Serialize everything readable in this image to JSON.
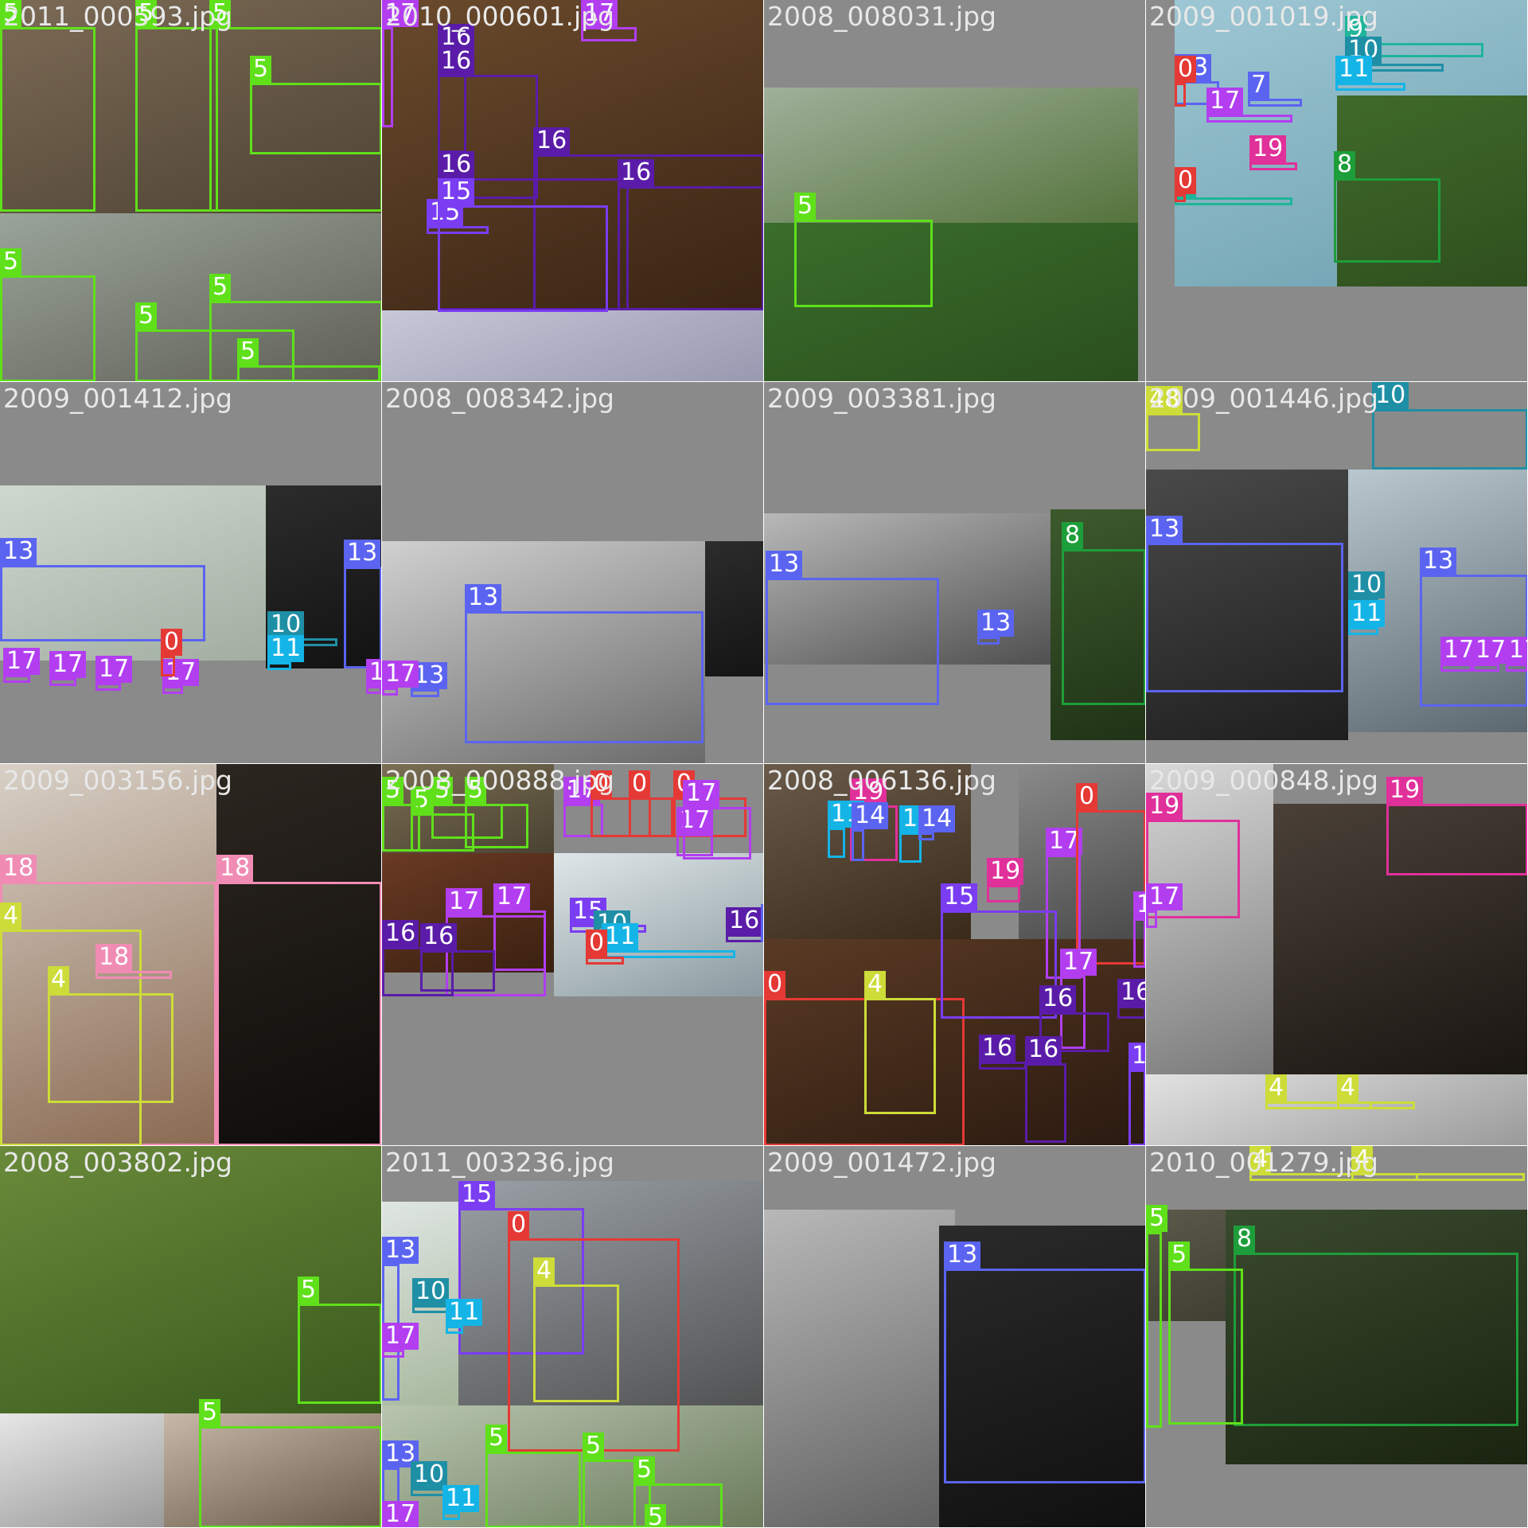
{
  "class_colors": {
    "0": "#e53935",
    "4": "#cddc39",
    "5": "#5fe01a",
    "8": "#1e9e3a",
    "9": "#1fb59a",
    "10": "#1f8fa5",
    "11": "#14b4e6",
    "13": "#5b64f0",
    "15": "#7a3df2",
    "16": "#5a1ca8",
    "17": "#b23ef0",
    "18": "#f08cb4",
    "19": "#e0309a"
  },
  "tiles": [
    {
      "filename": "2011_000593.jpg",
      "bg": "#8a8a8a",
      "photos": [
        [
          "#7b6a55",
          "#4f4334"
        ],
        [
          "#9aa49a",
          "#5f5f55"
        ]
      ],
      "boxes": [
        [
          "5"
        ],
        [
          "5"
        ],
        [
          "5"
        ],
        [
          "5"
        ],
        [
          "5"
        ],
        [
          "5"
        ],
        [
          "5"
        ],
        [
          "5"
        ]
      ]
    },
    {
      "filename": "2010_000601.jpg",
      "bg": "#8a8a8a",
      "photos": [
        [
          "#6a4a2c",
          "#3a2414"
        ],
        [
          "#c7c7d8",
          "#9898b0"
        ]
      ],
      "boxes": [
        [
          "17"
        ],
        [
          "17"
        ],
        [
          "16"
        ],
        [
          "16"
        ],
        [
          "15"
        ],
        [
          "16"
        ],
        [
          "16"
        ],
        [
          "15"
        ],
        [
          "16"
        ]
      ]
    },
    {
      "filename": "2008_008031.jpg",
      "bg": "#8a8a8a",
      "photos": [
        [
          "#9fb09a",
          "#55733c"
        ],
        [
          "#3a6e2b",
          "#2a4f1e"
        ]
      ],
      "boxes": [
        [
          "5"
        ]
      ]
    },
    {
      "filename": "2009_001019.jpg",
      "bg": "#8a8a8a",
      "photos": [
        [
          "#9ec7d4",
          "#6fa1b0"
        ],
        [
          "#3f6a2a",
          "#2f4f1e"
        ]
      ],
      "boxes": [
        [
          "13"
        ],
        [
          "9"
        ],
        [
          "0"
        ],
        [
          "10"
        ],
        [
          "11"
        ],
        [
          "17"
        ],
        [
          "7"
        ],
        [
          "8"
        ],
        [
          "9"
        ],
        [
          "0"
        ],
        [
          "19"
        ]
      ]
    },
    {
      "filename": "2009_001412.jpg",
      "bg": "#8a8a8a",
      "photos": [
        [
          "#cfd8cf",
          "#9ba79b"
        ],
        [
          "#2c2c2c",
          "#121212"
        ]
      ],
      "boxes": [
        [
          "13"
        ],
        [
          "13"
        ],
        [
          "10"
        ],
        [
          "11"
        ],
        [
          "17"
        ],
        [
          "17"
        ],
        [
          "17"
        ],
        [
          "17"
        ],
        [
          "17"
        ],
        [
          "0"
        ],
        [
          "0"
        ]
      ]
    },
    {
      "filename": "2008_008342.jpg",
      "bg": "#8a8a8a",
      "photos": [
        [
          "#d0d0d0",
          "#6a6a6a"
        ],
        [
          "#2c2c2c",
          "#141414"
        ]
      ],
      "boxes": [
        [
          "13"
        ],
        [
          "13"
        ],
        [
          "17"
        ]
      ]
    },
    {
      "filename": "2009_003381.jpg",
      "bg": "#8a8a8a",
      "photos": [
        [
          "#b8b8b8",
          "#505050"
        ],
        [
          "#3d5a2d",
          "#1f3316"
        ]
      ],
      "boxes": [
        [
          "13"
        ],
        [
          "13"
        ],
        [
          "8"
        ]
      ]
    },
    {
      "filename": "2009_001446.jpg",
      "bg": "#8a8a8a",
      "photos": [
        [
          "#4a4a4a",
          "#1e1e1e"
        ],
        [
          "#b9c7cf",
          "#5c6870"
        ]
      ],
      "boxes": [
        [
          "48"
        ],
        [
          "10"
        ],
        [
          "13"
        ],
        [
          "13"
        ],
        [
          "10"
        ],
        [
          "11"
        ],
        [
          "17"
        ],
        [
          "17"
        ],
        [
          "17"
        ]
      ]
    },
    {
      "filename": "2009_003156.jpg",
      "bg": "#e8e4e0",
      "photos": [
        [
          "#d8d0c6",
          "#8a6a52"
        ],
        [
          "#2c2620",
          "#0e0c0a"
        ]
      ],
      "boxes": [
        [
          "18"
        ],
        [
          "18"
        ],
        [
          "4"
        ],
        [
          "4"
        ],
        [
          "18"
        ]
      ]
    },
    {
      "filename": "2008_000888.jpg",
      "bg": "#8a8a8a",
      "photos": [
        [
          "#7a6e52",
          "#4a4232"
        ],
        [
          "#6a3a24",
          "#3a2010"
        ],
        [
          "#dfe6e8",
          "#8a9aa0"
        ]
      ],
      "boxes": [
        [
          "5"
        ],
        [
          "5"
        ],
        [
          "5"
        ],
        [
          "5"
        ],
        [
          "17"
        ],
        [
          "0"
        ],
        [
          "0"
        ],
        [
          "0"
        ],
        [
          "17"
        ],
        [
          "17"
        ],
        [
          "17"
        ],
        [
          "17"
        ],
        [
          "16"
        ],
        [
          "16"
        ],
        [
          "15"
        ],
        [
          "16"
        ],
        [
          "13"
        ],
        [
          "10"
        ],
        [
          "11"
        ],
        [
          "0"
        ],
        [
          "17"
        ]
      ]
    },
    {
      "filename": "2008_006136.jpg",
      "bg": "#8a8a8a",
      "photos": [
        [
          "#6a5a4a",
          "#3a2a1a"
        ],
        [
          "#8a8a8a",
          "#4a4a4a"
        ],
        [
          "#5a3a24",
          "#2a1a10"
        ]
      ],
      "boxes": [
        [
          "19"
        ],
        [
          "11"
        ],
        [
          "14"
        ],
        [
          "11"
        ],
        [
          "14"
        ],
        [
          "19"
        ],
        [
          "17"
        ],
        [
          "0"
        ],
        [
          "17"
        ],
        [
          "0"
        ],
        [
          "15"
        ],
        [
          "4"
        ],
        [
          "17"
        ],
        [
          "16"
        ],
        [
          "16"
        ],
        [
          "16"
        ],
        [
          "15"
        ],
        [
          "16"
        ]
      ]
    },
    {
      "filename": "2009_000848.jpg",
      "bg": "#8a8a8a",
      "photos": [
        [
          "#d8d8d8",
          "#7a7a7a"
        ],
        [
          "#4a4038",
          "#1a1612"
        ],
        [
          "#e2e2e2",
          "#9a9a9a"
        ]
      ],
      "boxes": [
        [
          "19"
        ],
        [
          "19"
        ],
        [
          "17"
        ],
        [
          "4"
        ],
        [
          "4"
        ]
      ]
    },
    {
      "filename": "2008_003802.jpg",
      "bg": "#8a8a8a",
      "photos": [
        [
          "#6a8a3a",
          "#3a5a1e"
        ],
        [
          "#e6e6e6",
          "#9a9a9a"
        ],
        [
          "#c7b8a8",
          "#6a5a4a"
        ]
      ],
      "boxes": [
        [
          "5"
        ],
        [
          "5"
        ]
      ]
    },
    {
      "filename": "2011_003236.jpg",
      "bg": "#8a8a8a",
      "photos": [
        [
          "#9aa0a6",
          "#4a4a4a"
        ],
        [
          "#dfe6e2",
          "#8aa07a"
        ],
        [
          "#b8c6b0",
          "#6a7a5a"
        ]
      ],
      "boxes": [
        [
          "15"
        ],
        [
          "0"
        ],
        [
          "4"
        ],
        [
          "13"
        ],
        [
          "10"
        ],
        [
          "11"
        ],
        [
          "17"
        ],
        [
          "5"
        ],
        [
          "5"
        ],
        [
          "5"
        ],
        [
          "5"
        ],
        [
          "13"
        ],
        [
          "10"
        ],
        [
          "11"
        ],
        [
          "17"
        ]
      ]
    },
    {
      "filename": "2009_001472.jpg",
      "bg": "#8a8a8a",
      "photos": [
        [
          "#b8b8b8",
          "#606060"
        ],
        [
          "#2a2a2a",
          "#101010"
        ]
      ],
      "boxes": [
        [
          "13"
        ]
      ]
    },
    {
      "filename": "2010_001279.jpg",
      "bg": "#8a8a8a",
      "photos": [
        [
          "#3a3a3a",
          "#1a1a1a"
        ],
        [
          "#5a5a4a",
          "#2a2a20"
        ],
        [
          "#3a4a2e",
          "#1a2410"
        ]
      ],
      "boxes": [
        [
          "4"
        ],
        [
          "4"
        ],
        [
          "8"
        ],
        [
          "5"
        ],
        [
          "5"
        ]
      ]
    }
  ]
}
